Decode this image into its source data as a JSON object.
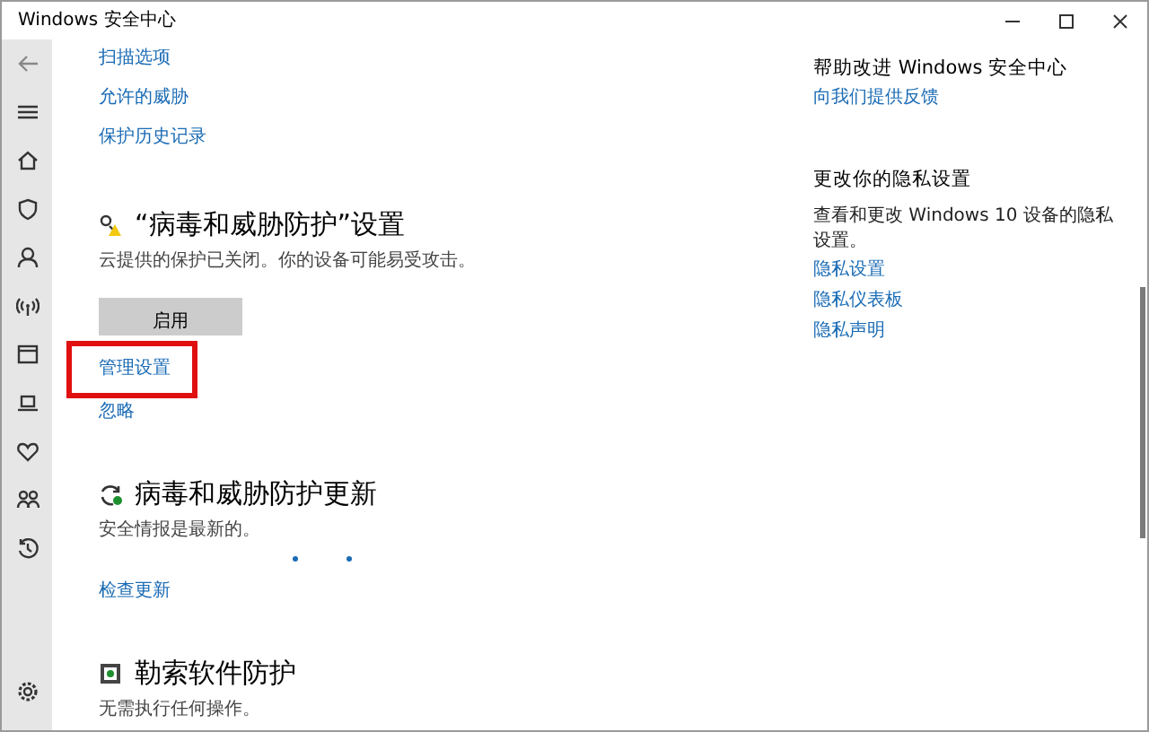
{
  "window": {
    "title": "Windows 安全中心"
  },
  "sidebar": {
    "items": [
      {
        "kind": "back"
      },
      {
        "kind": "menu"
      },
      {
        "kind": "home"
      },
      {
        "kind": "shield"
      },
      {
        "kind": "person"
      },
      {
        "kind": "antenna"
      },
      {
        "kind": "window"
      },
      {
        "kind": "laptop"
      },
      {
        "kind": "heart"
      },
      {
        "kind": "family"
      },
      {
        "kind": "history"
      },
      {
        "kind": "settings"
      }
    ]
  },
  "top_links": [
    "扫描选项",
    "允许的威胁",
    "保护历史记录"
  ],
  "sections": [
    {
      "kind": "settings",
      "title": "“病毒和威胁防护”设置",
      "description": "云提供的保护已关闭。你的设备可能易受攻击。",
      "button": "启用",
      "links": [
        {
          "label": "管理设置",
          "highlighted": true
        },
        {
          "label": "忽略",
          "highlighted": false
        }
      ]
    },
    {
      "kind": "update",
      "title": "病毒和威胁防护更新",
      "description": "安全情报是最新的。",
      "loading": true,
      "links": [
        {
          "label": "检查更新",
          "highlighted": false
        }
      ]
    },
    {
      "kind": "ransomware",
      "title": "勒索软件防护",
      "description": "无需执行任何操作。"
    }
  ],
  "right_panel": [
    {
      "title": "帮助改进 Windows 安全中心",
      "links": [
        "向我们提供反馈"
      ]
    },
    {
      "title": "更改你的隐私设置",
      "description": "查看和更改 Windows 10 设备的隐私设置。",
      "links": [
        "隐私设置",
        "隐私仪表板",
        "隐私声明"
      ]
    }
  ]
}
